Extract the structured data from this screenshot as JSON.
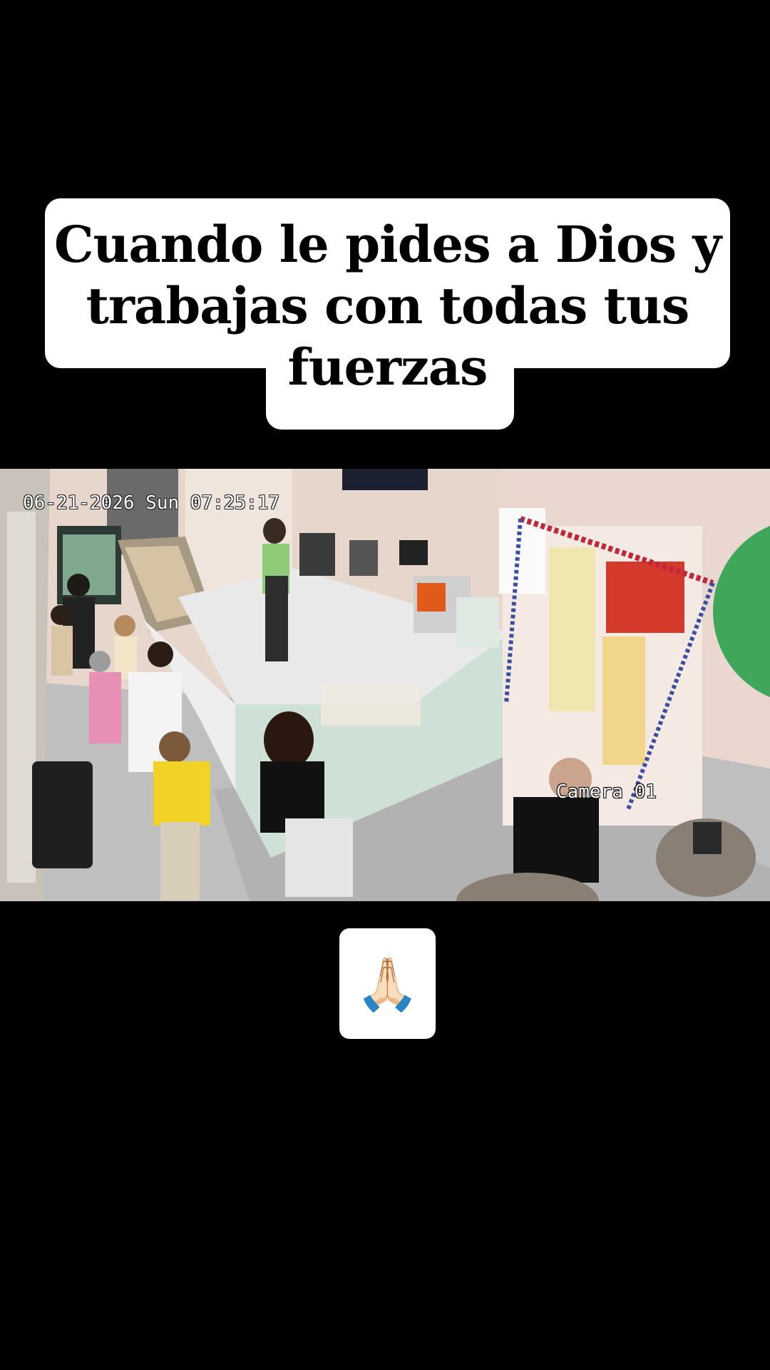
{
  "caption": {
    "text": "Cuando le pides a Dios y trabajas con todas tus fuerzas"
  },
  "video": {
    "timestamp": "06-21-2026 Sun 07:25:17",
    "camera_label": "Camera 01"
  },
  "reaction": {
    "emoji": "🙏🏻",
    "icon": "praying-hands-icon"
  }
}
